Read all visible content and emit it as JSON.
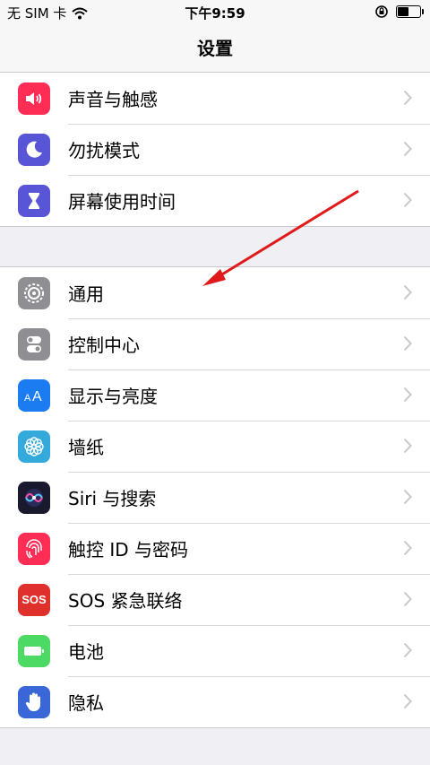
{
  "status_bar": {
    "carrier": "无 SIM 卡",
    "time": "下午9:59",
    "battery_level": 0.55
  },
  "nav": {
    "title": "设置"
  },
  "group1": [
    {
      "label": "声音与触感",
      "icon": "speaker-icon",
      "color": "#fe2d55"
    },
    {
      "label": "勿扰模式",
      "icon": "moon-icon",
      "color": "#5856d6"
    },
    {
      "label": "屏幕使用时间",
      "icon": "hourglass-icon",
      "color": "#5856d6"
    }
  ],
  "group2": [
    {
      "label": "通用",
      "icon": "gear-icon",
      "color": "#8e8e93"
    },
    {
      "label": "控制中心",
      "icon": "toggles-icon",
      "color": "#8e8e93"
    },
    {
      "label": "显示与亮度",
      "icon": "text-size-icon",
      "color": "#1a7cf0"
    },
    {
      "label": "墙纸",
      "icon": "flower-icon",
      "color": "#34aadc"
    },
    {
      "label": "Siri 与搜索",
      "icon": "siri-icon",
      "color": "#1a1a2e"
    },
    {
      "label": "触控 ID 与密码",
      "icon": "fingerprint-icon",
      "color": "#fe2d55"
    },
    {
      "label": "SOS 紧急联络",
      "icon": "sos-icon",
      "color": "#e0302b",
      "badge": "SOS"
    },
    {
      "label": "电池",
      "icon": "battery-icon",
      "color": "#4cd964"
    },
    {
      "label": "隐私",
      "icon": "hand-icon",
      "color": "#3a67d8"
    }
  ]
}
